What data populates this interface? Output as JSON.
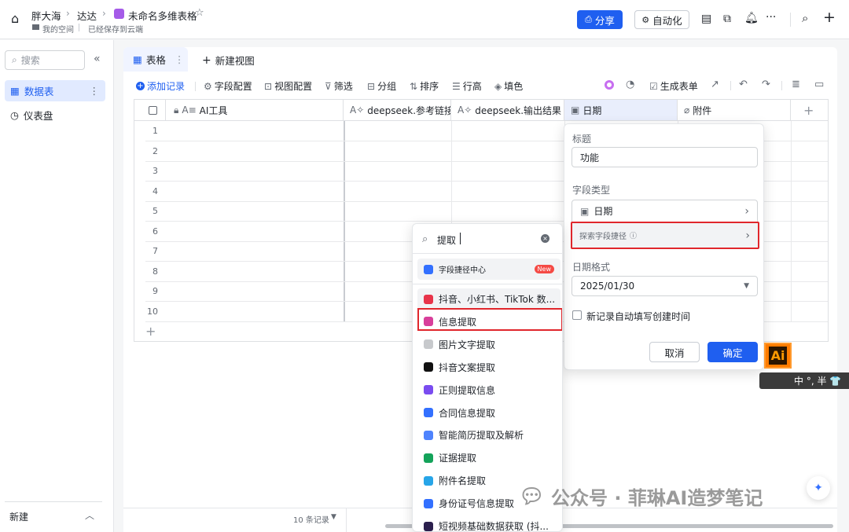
{
  "topbar": {
    "crumb1": "胖大海",
    "crumb2": "达达",
    "title": "未命名多维表格",
    "space": "我的空间",
    "saved": "已经保存到云端",
    "share": "分享",
    "automation": "自动化"
  },
  "sidebar": {
    "search_placeholder": "搜索",
    "items": [
      {
        "label": "数据表"
      },
      {
        "label": "仪表盘"
      }
    ],
    "new_label": "新建"
  },
  "tabs": {
    "table": "表格",
    "new_view": "新建视图"
  },
  "toolbar": {
    "add_record": "添加记录",
    "field_config": "字段配置",
    "view_config": "视图配置",
    "filter": "筛选",
    "group": "分组",
    "sort": "排序",
    "row_height": "行高",
    "fill": "填色",
    "gen_form": "生成表单"
  },
  "grid": {
    "columns": [
      "AI工具",
      "deepseek.参考链接",
      "deepseek.输出结果",
      "日期",
      "附件"
    ],
    "rows": [
      "1",
      "2",
      "3",
      "4",
      "5",
      "6",
      "7",
      "8",
      "9",
      "10"
    ],
    "records": "10 条记录"
  },
  "field_panel": {
    "title_label": "标题",
    "title_value": "功能",
    "type_label": "字段类型",
    "type_value": "日期",
    "explore": "探索字段捷径",
    "format_label": "日期格式",
    "format_value": "2025/01/30",
    "auto_fill": "新记录自动填写创建时间",
    "cancel": "取消",
    "confirm": "确定"
  },
  "shortcut_menu": {
    "query": "提取",
    "center": "字段捷径中心",
    "new_badge": "New",
    "items": [
      {
        "label": "抖音、小红书、TikTok 数...",
        "color": "#e8344a"
      },
      {
        "label": "信息提取",
        "color": "#d83f9b"
      },
      {
        "label": "图片文字提取",
        "color": "#c7c9cc"
      },
      {
        "label": "抖音文案提取",
        "color": "#111111"
      },
      {
        "label": "正则提取信息",
        "color": "#7a4cf0"
      },
      {
        "label": "合同信息提取",
        "color": "#3370ff"
      },
      {
        "label": "智能简历提取及解析",
        "color": "#4e83fd"
      },
      {
        "label": "证据提取",
        "color": "#14a35a"
      },
      {
        "label": "附件名提取",
        "color": "#27a5e8"
      },
      {
        "label": "身份证号信息提取",
        "color": "#3370ff"
      },
      {
        "label": "短视频基础数据获取 (抖...",
        "color": "#2b1f4d"
      }
    ]
  },
  "ime": {
    "ai_badge": "Ai",
    "bar": "中 °, 半 👕"
  },
  "watermark": "公众号 · 菲琳AI造梦笔记"
}
